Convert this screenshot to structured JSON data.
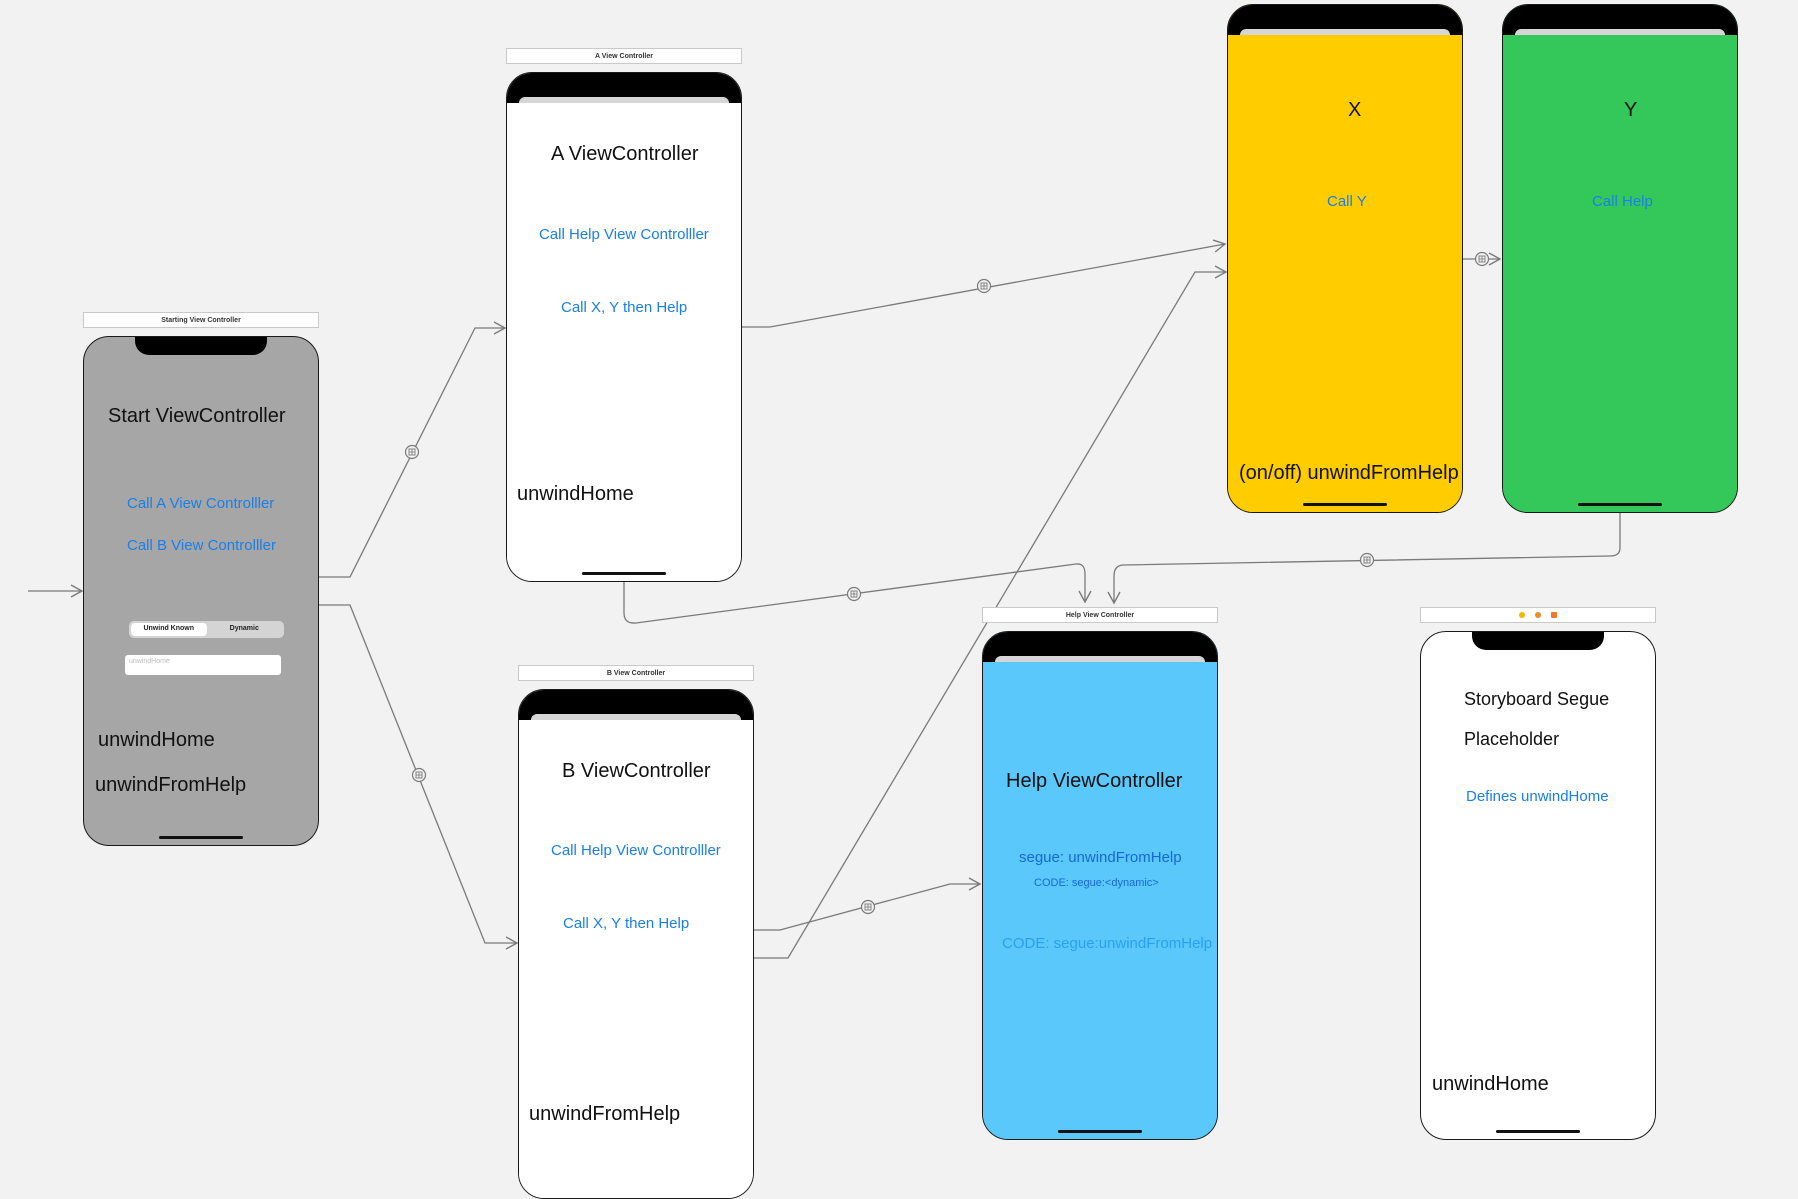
{
  "colors": {
    "canvas": "#f2f2f2",
    "start_bg": "#a6a6a6",
    "white_bg": "#ffffff",
    "x_bg": "#ffcc00",
    "y_bg": "#34c759",
    "help_bg": "#5ac8fa",
    "link": "#1a7fe8",
    "segue_line": "#7a7a7a"
  },
  "entry_arrow": {
    "icon": "entry-point-arrow-icon"
  },
  "scenes": {
    "start": {
      "scene_title": "Starting View Controller",
      "title": "Start ViewController",
      "call_a": "Call A View Controlller",
      "call_b": "Call B View Controlller",
      "segmented": {
        "selected": "Unwind Known",
        "other": "Dynamic"
      },
      "textfield_placeholder": "unwindHome",
      "label_unwind_home": "unwindHome",
      "label_unwind_help": "unwindFromHelp"
    },
    "a": {
      "scene_title": "A View Controller",
      "title": "A ViewController",
      "call_help": "Call Help View Controlller",
      "call_xy": "Call X, Y then Help",
      "label": "unwindHome"
    },
    "b": {
      "scene_title": "B View Controller",
      "title": "B ViewController",
      "call_help": "Call Help View Controlller",
      "call_xy": "Call X, Y then Help",
      "label": "unwindFromHelp"
    },
    "x": {
      "title": "X",
      "call_y": "Call Y",
      "label": "(on/off) unwindFromHelp"
    },
    "y": {
      "title": "Y",
      "call_help": "Call Help"
    },
    "help": {
      "scene_title": "Help View Controller",
      "title": "Help ViewController",
      "segue_button": "segue: unwindFromHelp",
      "code_dynamic": "CODE: segue:<dynamic>",
      "code_button": "CODE: segue:unwindFromHelp"
    },
    "placeholder": {
      "title_line1": "Storyboard  Segue",
      "title_line2": "Placeholder",
      "defines": "Defines unwindHome",
      "label": "unwindHome",
      "dock_icons": [
        "view-controller-icon",
        "first-responder-icon",
        "exit-icon"
      ]
    }
  },
  "segue_icon": "segue-badge-icon"
}
